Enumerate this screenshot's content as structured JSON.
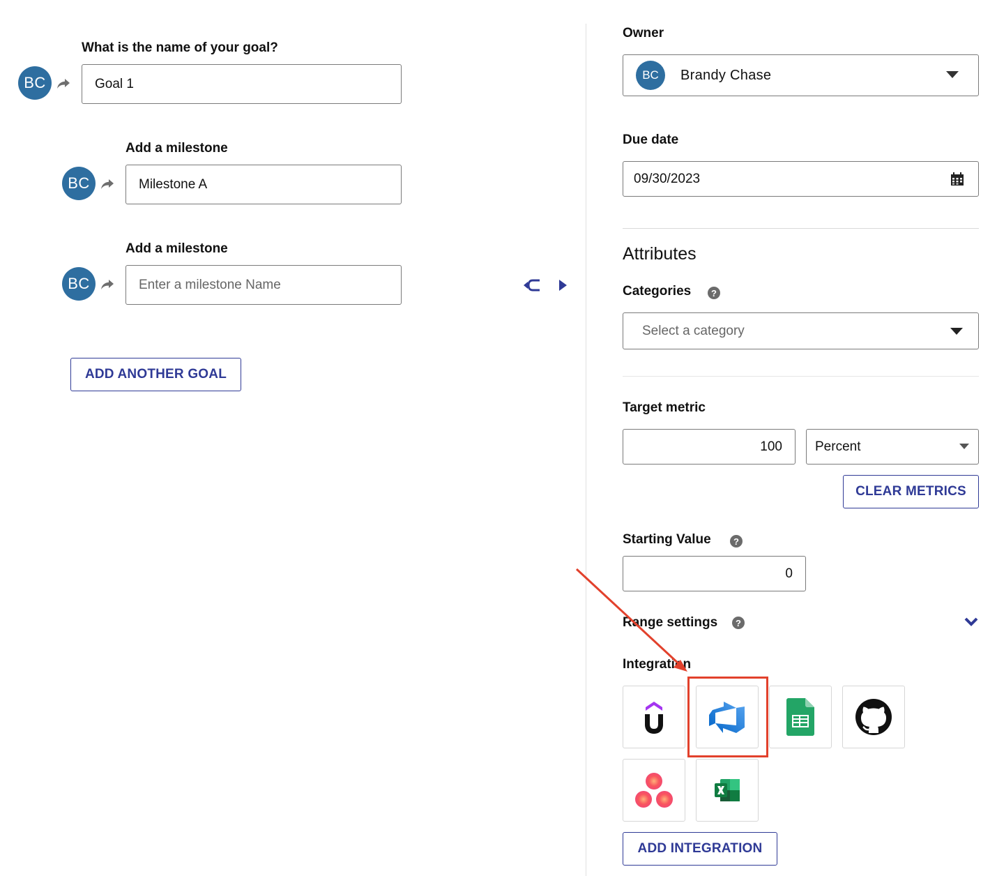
{
  "goal": {
    "question": "What is the name of your goal?",
    "avatar_initials": "BC",
    "value": "Goal 1"
  },
  "milestones": [
    {
      "label": "Add a milestone",
      "avatar_initials": "BC",
      "value": "Milestone A",
      "placeholder": ""
    },
    {
      "label": "Add a milestone",
      "avatar_initials": "BC",
      "value": "",
      "placeholder": "Enter a milestone Name"
    }
  ],
  "add_another_goal_label": "ADD ANOTHER GOAL",
  "owner": {
    "label": "Owner",
    "avatar_initials": "BC",
    "name": "Brandy Chase"
  },
  "due_date": {
    "label": "Due date",
    "value": "09/30/2023"
  },
  "attributes": {
    "heading": "Attributes",
    "categories_label": "Categories",
    "categories_placeholder": "Select a category"
  },
  "target_metric": {
    "label": "Target metric",
    "value": "100",
    "unit": "Percent",
    "clear_label": "CLEAR METRICS"
  },
  "starting_value": {
    "label": "Starting Value",
    "value": "0"
  },
  "range_settings_label": "Range settings",
  "integration": {
    "label": "Integration",
    "tiles": [
      "udemy-icon",
      "azure-devops-icon",
      "google-sheets-icon",
      "github-icon",
      "asana-icon",
      "excel-icon"
    ],
    "add_label": "ADD INTEGRATION"
  },
  "colors": {
    "accent": "#2f3a96",
    "avatar": "#2e6ea0",
    "annotation": "#e2412c"
  }
}
